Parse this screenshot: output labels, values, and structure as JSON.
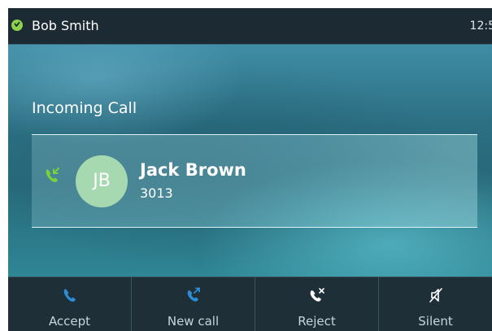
{
  "status_bar": {
    "user_name": "Bob Smith",
    "time": "12:5",
    "status_icon": "registered-check-icon",
    "status_color": "#8ed14b"
  },
  "incoming": {
    "title": "Incoming Call",
    "call_icon": "incoming-call-icon",
    "call_icon_color": "#7bd13b",
    "caller": {
      "initials": "JB",
      "name": "Jack Brown",
      "number": "3013",
      "avatar_color": "#a7d9b0"
    }
  },
  "softkeys": [
    {
      "label": "Accept",
      "icon": "phone-icon",
      "color": "#2c8ed6"
    },
    {
      "label": "New call",
      "icon": "new-call-icon",
      "color": "#2c8ed6"
    },
    {
      "label": "Reject",
      "icon": "reject-call-icon",
      "color": "#ffffff"
    },
    {
      "label": "Silent",
      "icon": "silent-icon",
      "color": "#ffffff"
    }
  ]
}
